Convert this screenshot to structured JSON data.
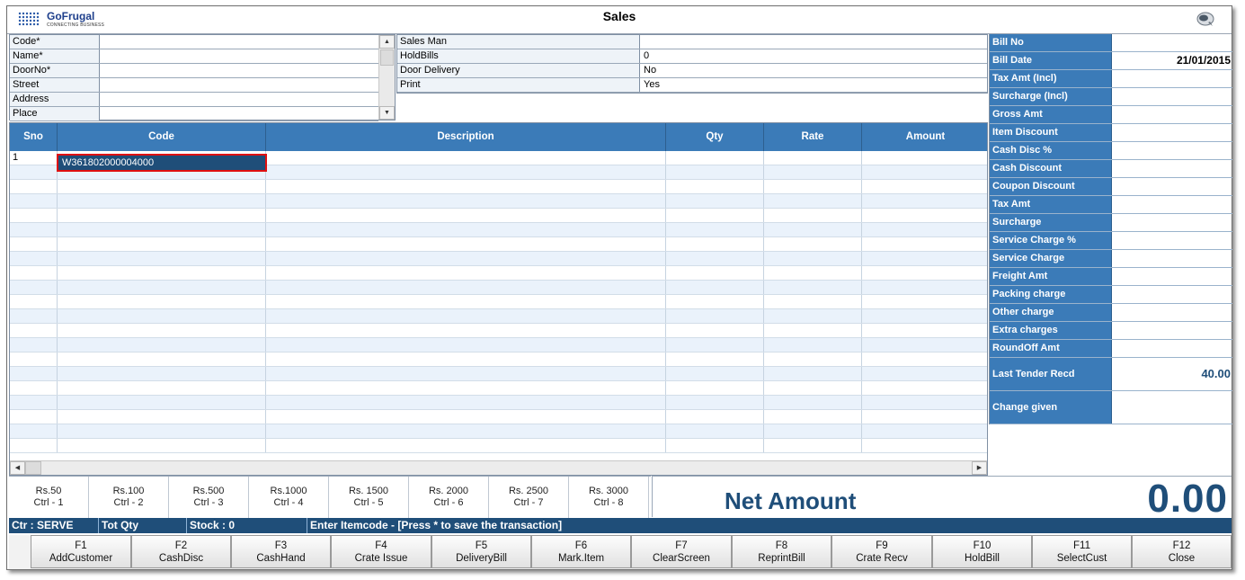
{
  "window": {
    "title": "Sales",
    "logo": {
      "brand": "GoFrugal",
      "tagline": "CONNECTING BUSINESS"
    }
  },
  "customer": {
    "fields": [
      {
        "label": "Code*",
        "value": ""
      },
      {
        "label": "Name*",
        "value": ""
      },
      {
        "label": "DoorNo*",
        "value": ""
      },
      {
        "label": "Street",
        "value": ""
      },
      {
        "label": "Address",
        "value": ""
      },
      {
        "label": "Place",
        "value": ""
      }
    ]
  },
  "sales_info": {
    "fields": [
      {
        "label": "Sales Man",
        "value": ""
      },
      {
        "label": "HoldBills",
        "value": "0"
      },
      {
        "label": "Door Delivery",
        "value": "No"
      },
      {
        "label": "Print",
        "value": "Yes"
      }
    ]
  },
  "bill": {
    "fields": [
      {
        "label": "Bill No",
        "value": ""
      },
      {
        "label": "Bill Date",
        "value": "21/01/2015"
      },
      {
        "label": "Tax Amt (Incl)",
        "value": ""
      },
      {
        "label": "Surcharge (Incl)",
        "value": ""
      },
      {
        "label": "Gross Amt",
        "value": ""
      },
      {
        "label": "Item Discount",
        "value": ""
      },
      {
        "label": "Cash Disc %",
        "value": ""
      },
      {
        "label": "Cash Discount",
        "value": ""
      },
      {
        "label": "Coupon Discount",
        "value": ""
      },
      {
        "label": "Tax Amt",
        "value": ""
      },
      {
        "label": "Surcharge",
        "value": ""
      },
      {
        "label": "Service Charge %",
        "value": ""
      },
      {
        "label": "Service Charge",
        "value": ""
      },
      {
        "label": "Freight Amt",
        "value": ""
      },
      {
        "label": "Packing charge",
        "value": ""
      },
      {
        "label": "Other charge",
        "value": ""
      },
      {
        "label": "Extra charges",
        "value": ""
      },
      {
        "label": "RoundOff Amt",
        "value": ""
      }
    ],
    "last_tender": {
      "label": "Last Tender Recd",
      "value": "40.00"
    },
    "change_given": {
      "label": "Change given",
      "value": ""
    }
  },
  "grid": {
    "columns": [
      "Sno",
      "Code",
      "Description",
      "Qty",
      "Rate",
      "Amount"
    ],
    "rows": [
      {
        "sno": "1",
        "code": "W361802000004000",
        "description": "",
        "qty": "",
        "rate": "",
        "amount": ""
      }
    ]
  },
  "denominations": [
    {
      "amount": "Rs.50",
      "key": "Ctrl - 1"
    },
    {
      "amount": "Rs.100",
      "key": "Ctrl - 2"
    },
    {
      "amount": "Rs.500",
      "key": "Ctrl - 3"
    },
    {
      "amount": "Rs.1000",
      "key": "Ctrl - 4"
    },
    {
      "amount": "Rs. 1500",
      "key": "Ctrl - 5"
    },
    {
      "amount": "Rs. 2000",
      "key": "Ctrl - 6"
    },
    {
      "amount": "Rs. 2500",
      "key": "Ctrl - 7"
    },
    {
      "amount": "Rs. 3000",
      "key": "Ctrl - 8"
    }
  ],
  "net_amount": {
    "label": "Net Amount",
    "value": "0.00"
  },
  "status": {
    "counter": "Ctr : SERVE",
    "tot_qty": "Tot Qty",
    "stock": "Stock : 0",
    "hint": "Enter Itemcode - [Press * to save the transaction]"
  },
  "function_keys": [
    {
      "key": "F1",
      "label": "AddCustomer"
    },
    {
      "key": "F2",
      "label": "CashDisc"
    },
    {
      "key": "F3",
      "label": "CashHand"
    },
    {
      "key": "F4",
      "label": "Crate Issue"
    },
    {
      "key": "F5",
      "label": "DeliveryBill"
    },
    {
      "key": "F6",
      "label": "Mark.Item"
    },
    {
      "key": "F7",
      "label": "ClearScreen"
    },
    {
      "key": "F8",
      "label": "ReprintBill"
    },
    {
      "key": "F9",
      "label": "Crate Recv"
    },
    {
      "key": "F10",
      "label": "HoldBill"
    },
    {
      "key": "F11",
      "label": "SelectCust"
    },
    {
      "key": "F12",
      "label": "Close"
    }
  ],
  "colors": {
    "header_blue": "#3b7bb8",
    "dark_blue": "#1f4e79",
    "alt_row": "#eaf2fb",
    "highlight": "#e01010"
  }
}
